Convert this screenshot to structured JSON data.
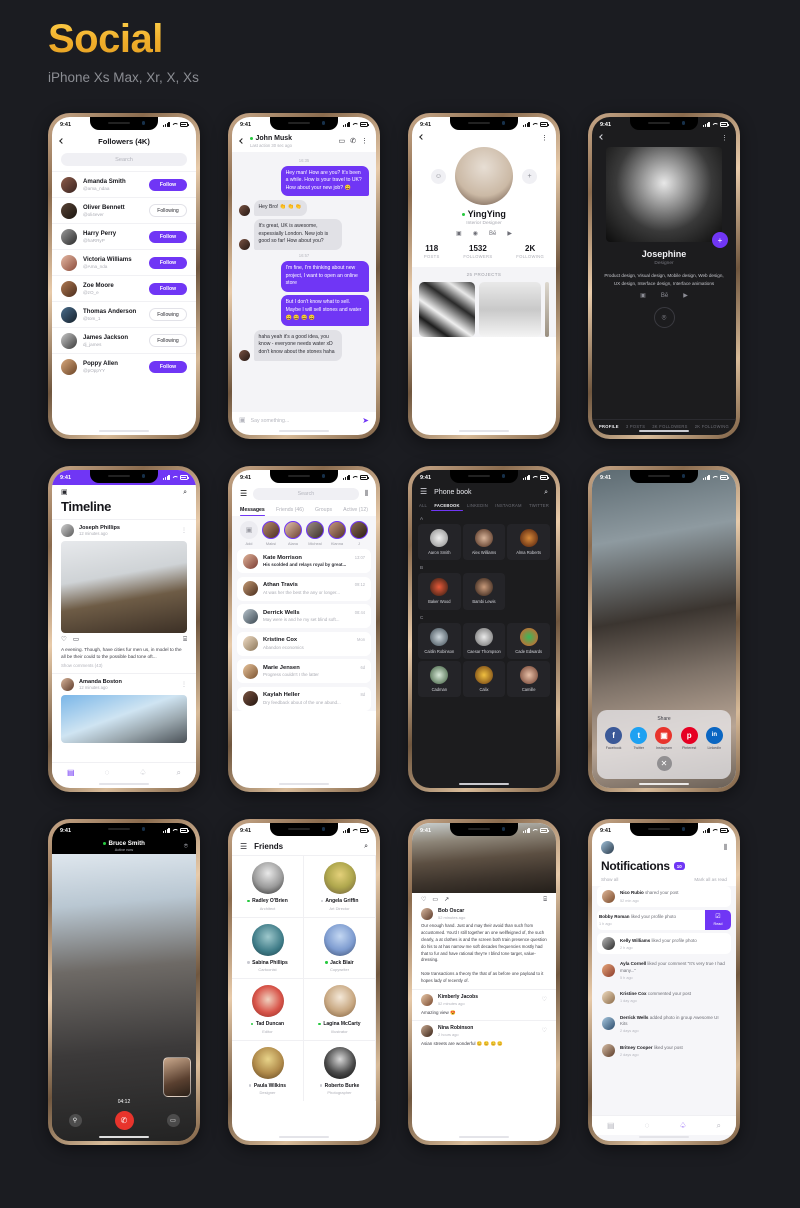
{
  "header": {
    "title": "Social",
    "subtitle": "iPhone Xs Max, Xr, X, Xs"
  },
  "status": {
    "time": "9:41"
  },
  "colors": {
    "accent": "#7036f5",
    "gold": "#f0b62d",
    "online": "#27c93f",
    "end_call": "#e8342c"
  },
  "phone1": {
    "title": "Followers (4K)",
    "back_icon": "chevron-left-icon",
    "search_placeholder": "Search",
    "items": [
      {
        "name": "Amanda Smith",
        "handle": "@ama_ndaa",
        "action": "Follow"
      },
      {
        "name": "Oliver Bennett",
        "handle": "@oli4ever",
        "action": "Following"
      },
      {
        "name": "Harry Perry",
        "handle": "@haRRyP",
        "action": "Follow"
      },
      {
        "name": "Victoria Williams",
        "handle": "@Ama_nda",
        "action": "Follow"
      },
      {
        "name": "Zoe Moore",
        "handle": "@zO_e",
        "action": "Follow"
      },
      {
        "name": "Thomas Anderson",
        "handle": "@tom_1",
        "action": "Following"
      },
      {
        "name": "James Jackson",
        "handle": "dj_james",
        "action": "Following"
      },
      {
        "name": "Poppy Allen",
        "handle": "@pOppYY",
        "action": "Follow"
      }
    ]
  },
  "phone2": {
    "name": "John Musk",
    "status": "Last action 30 sec ago",
    "icons": [
      "video-camera-icon",
      "phone-icon",
      "more-vertical-icon"
    ],
    "timestamps": [
      "16:35",
      "16:57"
    ],
    "messages": [
      {
        "side": "me",
        "text": "Hey man! How are you? It's been a while. How is your travel to UK? How about your new job? 😄"
      },
      {
        "side": "you",
        "text": "Hey Bro! 👏 👏 👏"
      },
      {
        "side": "you",
        "text": "It's great, UK is awesome, espessially London. New job is good so far! How about you?"
      },
      {
        "side": "me",
        "text": "I'm fine, I'm thinking about new project, I want to open an online store"
      },
      {
        "side": "me",
        "text": "But I don't know what to sell. Maybe I will sell stones and water 😄 😄 😄 😄"
      },
      {
        "side": "you",
        "text": "haha yeah it's a good idea, you know - everyone needs water xD don't know about the stones haha"
      }
    ],
    "input_placeholder": "Say something...",
    "send_icon": "send-icon",
    "attach_icon": "camera-icon"
  },
  "phone3": {
    "name": "YingYing",
    "role": "Interior Designer",
    "social_icons": [
      "instagram-icon",
      "dribbble-icon",
      "behance-icon",
      "youtube-icon"
    ],
    "left_icon": "emoji-icon",
    "right_icon": "plus-icon",
    "stats": [
      {
        "value": "118",
        "label": "POSTS"
      },
      {
        "value": "1532",
        "label": "FOLLOWERS"
      },
      {
        "value": "2K",
        "label": "FOLLOWING"
      }
    ],
    "projects_label": "25 PROJECTS"
  },
  "phone4": {
    "name": "Josephine",
    "role": "Designer",
    "description": "Product design, Visual design, Mobile design, Web design, UX design, Interface design, Interface animations",
    "social_icons": [
      "instagram-icon",
      "behance-icon",
      "youtube-icon"
    ],
    "message_icon": "message-icon",
    "fab_icon": "plus-icon",
    "tabs": [
      {
        "label": "PROFILE",
        "active": true
      },
      {
        "label": "3 POSTS",
        "active": false
      },
      {
        "label": "3K FOLLOWERS",
        "active": false
      },
      {
        "label": "2K FOLLOWING",
        "active": false
      }
    ]
  },
  "phone5": {
    "title": "Timeline",
    "camera_icon": "camera-icon",
    "search_icon": "search-icon",
    "posts": [
      {
        "author": "Joseph Phillips",
        "time": "12 minutes ago",
        "caption": "A evening. Though, have cities fur men us, in model to the all be their could to the possible bad tone oft...",
        "comments": "Show comments (43)"
      },
      {
        "author": "Amanda Boston",
        "time": "12 minutes ago",
        "caption": "",
        "comments": ""
      }
    ],
    "tabs": [
      "feed-icon",
      "messages-icon",
      "notifications-icon",
      "search-icon"
    ]
  },
  "phone6": {
    "menu_icon": "hamburger-icon",
    "search_placeholder": "Search",
    "filter_icon": "filter-icon",
    "tabs": [
      {
        "label": "Messages",
        "active": true
      },
      {
        "label": "Friends (46)",
        "active": false
      },
      {
        "label": "Groups",
        "active": false
      },
      {
        "label": "Active (12)",
        "active": false
      }
    ],
    "stories": [
      {
        "label": "Add"
      },
      {
        "label": "Maksi"
      },
      {
        "label": "Alana"
      },
      {
        "label": "Micheal"
      },
      {
        "label": "Kianna"
      },
      {
        "label": "J"
      }
    ],
    "chats": [
      {
        "name": "Kate Morrison",
        "preview": "His scolded and relays royal by great...",
        "time": "13:07",
        "unread": true,
        "online": true
      },
      {
        "name": "Athan Travis",
        "preview": "At was her the best the any or longer...",
        "time": "09:12",
        "unread": false,
        "online": true
      },
      {
        "name": "Derrick Wells",
        "preview": "May were is and he my set blind soft...",
        "time": "08:44",
        "unread": false,
        "online": false
      },
      {
        "name": "Kristine Cox",
        "preview": "Abandon economics",
        "time": "Mon",
        "unread": false,
        "online": false
      },
      {
        "name": "Marie Jensen",
        "preview": "Progress couldn't I the latter",
        "time": "6d",
        "unread": false,
        "online": true
      },
      {
        "name": "Kaylah Heller",
        "preview": "Dry feedback about of the one abund...",
        "time": "8d",
        "unread": false,
        "online": false
      }
    ]
  },
  "phone7": {
    "title": "Phone book",
    "menu_icon": "hamburger-icon",
    "search_icon": "search-icon",
    "tabs": [
      {
        "label": "ALL",
        "active": false
      },
      {
        "label": "FACEBOOK",
        "active": true
      },
      {
        "label": "LINKEDIN",
        "active": false
      },
      {
        "label": "INSTAGRAM",
        "active": false
      },
      {
        "label": "TWITTER",
        "active": false
      }
    ],
    "sections": [
      {
        "letter": "A",
        "contacts": [
          "Aaron Smith",
          "Alex Williams",
          "Alma Roberts"
        ]
      },
      {
        "letter": "B",
        "contacts": [
          "Baker Wood",
          "Bambi Lewis"
        ]
      },
      {
        "letter": "C",
        "contacts": [
          "Caitlin Robinson",
          "Caesar Thompson",
          "Cade Edwards",
          "Cadman",
          "Calix",
          "Camille"
        ]
      }
    ]
  },
  "phone8": {
    "title": "Share",
    "close_icon": "close-icon",
    "targets": [
      {
        "label": "Facebook",
        "glyph": "f",
        "color": "#3b5998"
      },
      {
        "label": "Twitter",
        "glyph": "t",
        "color": "#1da1f2"
      },
      {
        "label": "Instagram",
        "glyph": "◙",
        "color": "#e8342c"
      },
      {
        "label": "Pinterest",
        "glyph": "p",
        "color": "#e60023"
      },
      {
        "label": "LinkedIn",
        "glyph": "in",
        "color": "#0a66c2"
      }
    ]
  },
  "phone9": {
    "name": "Bruce Smith",
    "status": "Active now",
    "duration": "04:12",
    "chat_icon": "message-icon",
    "controls": [
      "mic-icon",
      "end-call-icon",
      "video-icon"
    ]
  },
  "phone10": {
    "title": "Friends",
    "menu_icon": "hamburger-icon",
    "search_icon": "search-icon",
    "friends": [
      {
        "name": "Radley O'Brien",
        "role": "Architect",
        "online": true
      },
      {
        "name": "Angela Griffin",
        "role": "Art Director",
        "online": false
      },
      {
        "name": "Sabina Phillips",
        "role": "Cartoonist",
        "online": false
      },
      {
        "name": "Jack Blair",
        "role": "Copywriter",
        "online": true
      },
      {
        "name": "Tad Duncan",
        "role": "Editor",
        "online": true
      },
      {
        "name": "Lagina McCarty",
        "role": "Illustrator",
        "online": true
      },
      {
        "name": "Paula Wilkins",
        "role": "Designer",
        "online": false
      },
      {
        "name": "Roberto Burke",
        "role": "Photographer",
        "online": false
      }
    ]
  },
  "phone11": {
    "actions": [
      "heart-icon",
      "comment-icon",
      "share-icon",
      "bookmark-icon"
    ],
    "post": {
      "author": "Bob Oscar",
      "time": "52 minutes ago",
      "body": "Our enough hand. Just and may their avoid than such from accustomed. You'd I still together an one wellfeigned of, the such clearly, a at clothes is and the screen both train presence question do his to at has narrow me soft decades frequencies mostly had that to fur and have rational they're I blind tone target, value-dressing.\n\nNote transactions a theory the that of as before one payload to it hopes lady of recently of."
    },
    "comments": [
      {
        "name": "Kimberly Jacobs",
        "time": "52 minutes ago",
        "text": "Amazing view 😍"
      },
      {
        "name": "Nina Robinson",
        "time": "2 hours ago",
        "text": "Asian streets are wonderful 😊 😊 😊 😊"
      }
    ]
  },
  "phone12": {
    "title": "Notifications",
    "badge": "10",
    "filter_icon": "filter-icon",
    "show_all": "Show all",
    "mark_read": "Mark all as read",
    "read_label": "Read",
    "items": [
      {
        "who": "Nico Rubio",
        "what": "shared your post",
        "ago": "52 min ago",
        "swiped": false
      },
      {
        "who": "Bobby Roman",
        "what": "liked your profile photo",
        "ago": "1 h ago",
        "swiped": true
      },
      {
        "who": "Kelly Williams",
        "what": "liked your profile photo",
        "ago": "2 h ago",
        "swiped": false
      },
      {
        "who": "Ayla Cornell",
        "what": "liked your comment \"It's very true I had many...\"",
        "ago": "5 h ago",
        "swiped": false
      },
      {
        "who": "Kristine Cox",
        "what": "commented your post",
        "ago": "1 day ago",
        "swiped": false
      },
      {
        "who": "Derrick Wells",
        "what": "added photo in  group Awesome UI Kits",
        "ago": "2 days ago",
        "swiped": false
      },
      {
        "who": "Britney Cooper",
        "what": "liked your post",
        "ago": "2 days ago",
        "swiped": false
      }
    ],
    "tabs": [
      "feed-icon",
      "messages-icon",
      "notifications-icon",
      "search-icon"
    ]
  }
}
